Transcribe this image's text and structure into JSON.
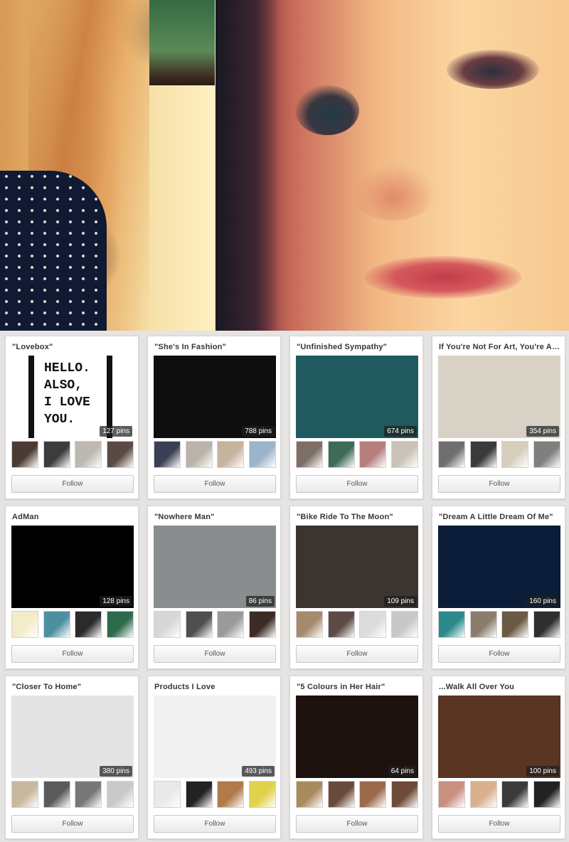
{
  "boards": [
    {
      "title": "\"Lovebox\"",
      "pins": "127 pins",
      "follow": "Follow",
      "cover_text": [
        "HELLO.",
        "ALSO,",
        "I LOVE",
        "YOU."
      ],
      "colors": {
        "cover": "#ffffff",
        "thumbs": [
          "#4a3b33",
          "#3c3c3c",
          "#bdb8b2",
          "#5a4a44"
        ]
      }
    },
    {
      "title": "\"She's In Fashion\"",
      "pins": "788 pins",
      "follow": "Follow",
      "colors": {
        "cover": "#0e0e0e",
        "thumbs": [
          "#3b3f55",
          "#b9b3a8",
          "#c6b39e",
          "#9bb4c9"
        ]
      }
    },
    {
      "title": "\"Unfinished Sympathy\"",
      "pins": "674 pins",
      "follow": "Follow",
      "colors": {
        "cover": "#1f5a5e",
        "thumbs": [
          "#7d6f66",
          "#3d6b55",
          "#b77e7e",
          "#c9c2b5"
        ]
      }
    },
    {
      "title": "If You're Not For Art, You're Against It",
      "pins": "354 pins",
      "follow": "Follow",
      "colors": {
        "cover": "#d8d1c6",
        "thumbs": [
          "#6f6f6f",
          "#3a3a3a",
          "#d7cdbd",
          "#7f7f7f"
        ]
      }
    },
    {
      "title": "AdMan",
      "pins": "128 pins",
      "follow": "Follow",
      "colors": {
        "cover": "#000000",
        "thumbs": [
          "#f2ecc9",
          "#4d8fa0",
          "#2b2b2b",
          "#2e6b4d"
        ]
      }
    },
    {
      "title": "\"Nowhere Man\"",
      "pins": "86 pins",
      "follow": "Follow",
      "colors": {
        "cover": "#8a8d8e",
        "thumbs": [
          "#d7d7d7",
          "#4f4f4f",
          "#9a9a9a",
          "#3d2c25"
        ]
      }
    },
    {
      "title": "\"Bike Ride To The Moon\"",
      "pins": "109 pins",
      "follow": "Follow",
      "colors": {
        "cover": "#3a3530",
        "thumbs": [
          "#a68a6e",
          "#5e4a46",
          "#dcdcdc",
          "#c8c8c8"
        ]
      }
    },
    {
      "title": "\"Dream A Little Dream Of Me\"",
      "pins": "160 pins",
      "follow": "Follow",
      "colors": {
        "cover": "#0c1d3a",
        "thumbs": [
          "#2c8a8c",
          "#8a7d6c",
          "#6b5a44",
          "#2f2f2f"
        ]
      }
    },
    {
      "title": "\"Closer To Home\"",
      "pins": "380 pins",
      "follow": "Follow",
      "colors": {
        "cover": "#e4e4e4",
        "thumbs": [
          "#c7b89e",
          "#5a5a5a",
          "#777777",
          "#c9c9c9"
        ]
      }
    },
    {
      "title": "Products I Love",
      "pins": "493 pins",
      "follow": "Follow",
      "colors": {
        "cover": "#f1f1f1",
        "thumbs": [
          "#e9e9e9",
          "#222222",
          "#b07a4a",
          "#e1d24b"
        ]
      }
    },
    {
      "title": "\"5 Colours in Her Hair\"",
      "pins": "64 pins",
      "follow": "Follow",
      "colors": {
        "cover": "#1d120d",
        "thumbs": [
          "#a88b5c",
          "#6a4b3b",
          "#9a6a4a",
          "#6e4b38"
        ]
      }
    },
    {
      "title": "...Walk All Over You",
      "pins": "100 pins",
      "follow": "Follow",
      "colors": {
        "cover": "#5a3522",
        "thumbs": [
          "#c98f7f",
          "#d8b08c",
          "#3a3a3a",
          "#222222"
        ]
      }
    }
  ]
}
